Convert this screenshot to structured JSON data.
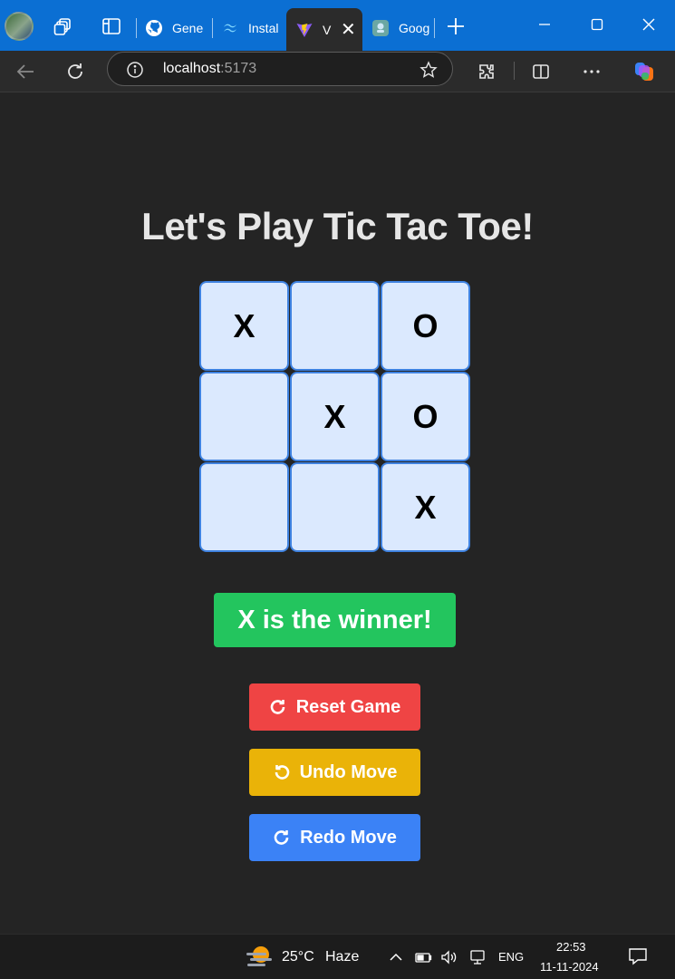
{
  "browser": {
    "tabs": [
      {
        "label": "Gene",
        "icon": "github-icon"
      },
      {
        "label": "Instal",
        "icon": "tailwind-icon"
      },
      {
        "label": "V",
        "icon": "vite-icon",
        "active": true
      },
      {
        "label": "Goog",
        "icon": "google-icon"
      }
    ],
    "url_host": "localhost",
    "url_port": ":5173"
  },
  "app": {
    "title": "Let's Play Tic Tac Toe!",
    "board": [
      "X",
      "",
      "O",
      "",
      "X",
      "O",
      "",
      "",
      "X"
    ],
    "status": "X is the winner!",
    "buttons": {
      "reset": "Reset Game",
      "undo": "Undo Move",
      "redo": "Redo Move"
    },
    "colors": {
      "cell_bg": "#dbe9fe",
      "cell_border": "#3f82e0",
      "status_bg": "#23c55e",
      "reset_bg": "#ef4444",
      "undo_bg": "#eab308",
      "redo_bg": "#3b82f6"
    }
  },
  "taskbar": {
    "temperature": "25°C",
    "condition": "Haze",
    "language": "ENG",
    "time": "22:53",
    "date": "11-11-2024"
  }
}
